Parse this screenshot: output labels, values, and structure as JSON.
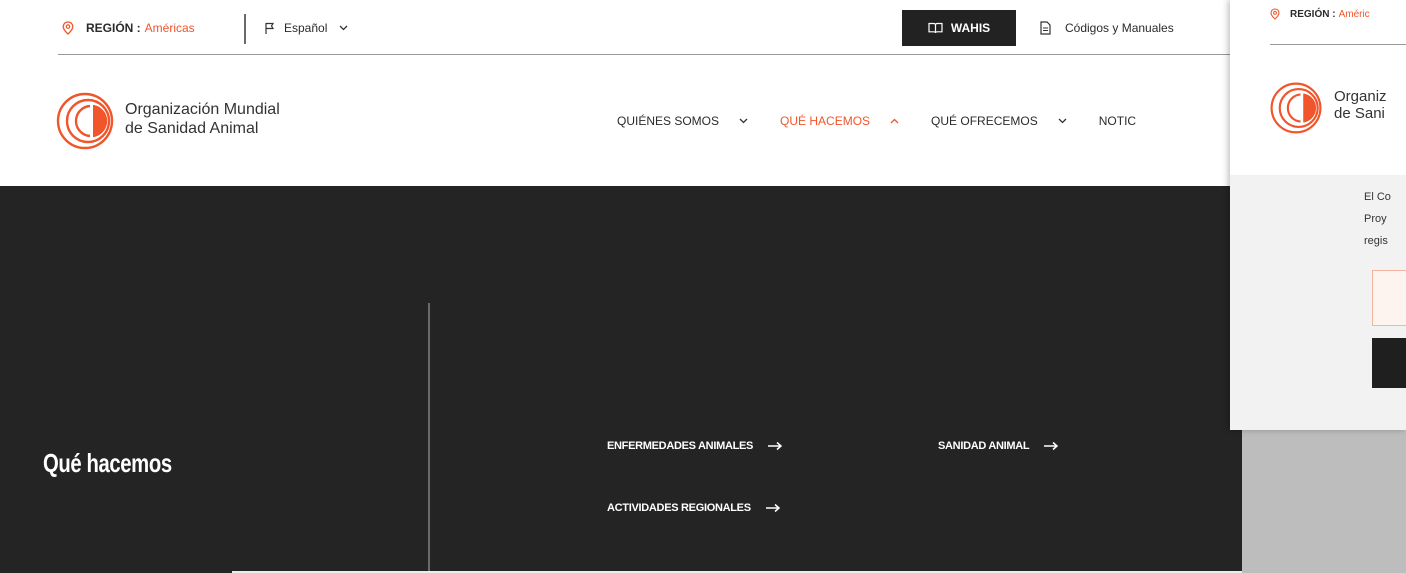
{
  "topbar": {
    "region_label": "REGIÓN :",
    "region_value": "Américas",
    "language": "Español",
    "wahis_label": "WAHIS",
    "codigos_label": "Códigos y Manuales"
  },
  "header": {
    "org_line1": "Organización Mundial",
    "org_line2": "de Sanidad Animal"
  },
  "menu": [
    {
      "label": "QUIÉNES SOMOS",
      "active": false
    },
    {
      "label": "QUÉ HACEMOS",
      "active": true
    },
    {
      "label": "QUÉ OFRECEMOS",
      "active": false
    },
    {
      "label": "NOTIC",
      "active": false
    }
  ],
  "submenu": {
    "title": "Qué hacemos",
    "links": [
      {
        "label": "ENFERMEDADES ANIMALES"
      },
      {
        "label": "SANIDAD ANIMAL"
      },
      {
        "label": "ACTIVIDADES REGIONALES"
      }
    ]
  },
  "second_window": {
    "region_label": "REGIÓN :",
    "region_value": "Améric",
    "org_line1": "Organiz",
    "org_line2": "de Sani",
    "text_line1": "El Co",
    "text_line2": "Proy",
    "text_line3": "regis"
  },
  "colors": {
    "accent": "#f0552b",
    "dark_bg": "#242424",
    "text": "#2b2b2b"
  },
  "icons": [
    "location-pin-icon",
    "flag-icon",
    "chevron-down-icon",
    "chevron-up-icon",
    "book-icon",
    "document-icon",
    "arrow-right-icon",
    "woah-logo"
  ]
}
